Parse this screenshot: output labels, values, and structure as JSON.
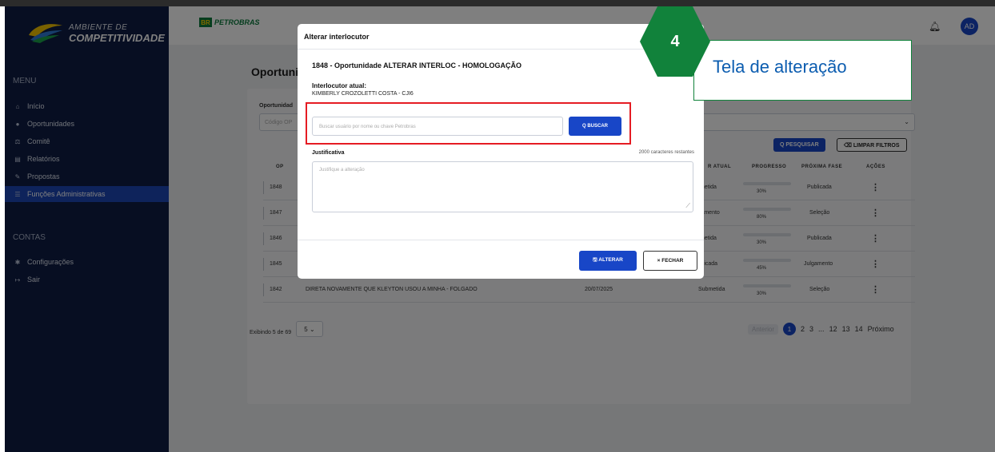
{
  "sidebar": {
    "logo_line1": "AMBIENTE DE",
    "logo_line2": "COMPETITIVIDADE",
    "menu_title": "MENU",
    "items": [
      {
        "label": "Início",
        "icon": "home-icon"
      },
      {
        "label": "Oportunidades",
        "icon": "pin-icon"
      },
      {
        "label": "Comitê",
        "icon": "scale-icon"
      },
      {
        "label": "Relatórios",
        "icon": "document-icon"
      },
      {
        "label": "Propostas",
        "icon": "pencil-icon"
      },
      {
        "label": "Funções Administrativas",
        "icon": "list-icon",
        "active": true
      }
    ],
    "contas_title": "CONTAS",
    "contas_items": [
      {
        "label": "Configurações",
        "icon": "gear-icon"
      },
      {
        "label": "Sair",
        "icon": "logout-icon"
      }
    ]
  },
  "header": {
    "brand_box": "BR",
    "brand": "PETROBRAS",
    "avatar": "AD"
  },
  "main": {
    "page_title": "Oportuni",
    "filter_label": "Oportunidad",
    "filter_placeholder": "Código OP",
    "btn_pesquisar": "Q PESQUISAR",
    "btn_limpar": "⌫ LIMPAR FILTROS",
    "columns": {
      "op": "OP",
      "fase_atual": "R ATUAL",
      "progresso": "PROGRESSO",
      "proxima_fase": "PRÓXIMA FASE",
      "acoes": "AÇÕES"
    },
    "rows": [
      {
        "op": "1848",
        "title": "",
        "date": "",
        "fase": "bmetida",
        "progress_pct": 30,
        "progress": "30%",
        "proxima": "Publicada"
      },
      {
        "op": "1847",
        "title": "",
        "date": "",
        "fase": "lgamento",
        "progress_pct": 80,
        "progress": "80%",
        "proxima": "Seleção"
      },
      {
        "op": "1846",
        "title": "",
        "date": "",
        "fase": "bmetida",
        "progress_pct": 30,
        "progress": "30%",
        "proxima": "Publicada"
      },
      {
        "op": "1845",
        "title": "",
        "date": "",
        "fase": "ublicada",
        "progress_pct": 45,
        "progress": "45%",
        "proxima": "Julgamento"
      },
      {
        "op": "1842",
        "title": "DIRETA NOVAMENTE QUE KLEYTON USOU A MINHA - FOLGADO",
        "date": "20/07/2025",
        "fase": "Submetida",
        "progress_pct": 30,
        "progress": "30%",
        "proxima": "Seleção"
      }
    ],
    "showing": "Exibindo 5 de 69",
    "page_size": "5",
    "pagination": {
      "anterior": "Anterior",
      "pages": [
        "1",
        "2",
        "3",
        "...",
        "12",
        "13",
        "14"
      ],
      "proximo": "Próximo"
    }
  },
  "modal": {
    "title": "Alterar interlocutor",
    "op_title": "1848 - Oportunidade ALTERAR INTERLOC - HOMOLOGAÇÃO",
    "interlocutor_label": "Interlocutor atual:",
    "interlocutor_value": "KIMBERLY CROZOLETTI COSTA - CJI6",
    "search_placeholder": "Buscar usuário por nome ou chave Petrobras",
    "btn_buscar": "Q BUSCAR",
    "justificativa_label": "Justificativa",
    "chars_remaining": "2000 caracteres restantes",
    "justificativa_placeholder": "Justifique a alteração",
    "btn_alterar": "🖫 ALTERAR",
    "btn_fechar": "× FECHAR"
  },
  "callout": {
    "step": "4",
    "text": "Tela de alteração"
  },
  "colors": {
    "sidebar": "#0f1d45",
    "primary": "#1846c7",
    "callout_green": "#11823b",
    "highlight_red": "#e51c23",
    "progress": "#e0a800"
  }
}
